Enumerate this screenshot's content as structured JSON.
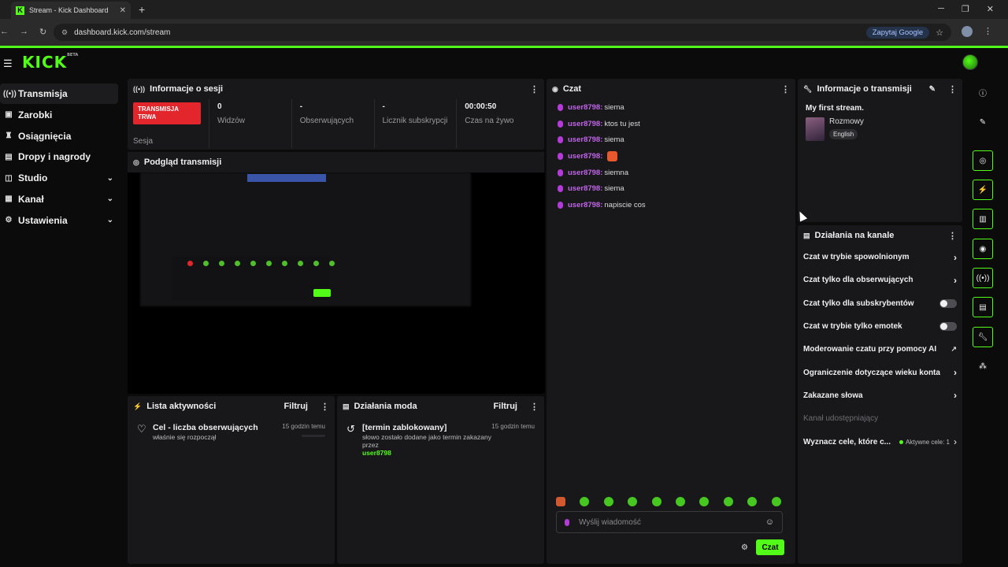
{
  "browser": {
    "tab_title": "Stream - Kick Dashboard",
    "url": "dashboard.kick.com/stream",
    "google_chip": "Zapytaj Google"
  },
  "brand": {
    "logo": "KICK",
    "beta": "BETA",
    "accent": "#53fc18"
  },
  "sidebar": {
    "items": [
      {
        "label": "Transmisja",
        "icon": "broadcast-icon",
        "active": true
      },
      {
        "label": "Zarobki",
        "icon": "wallet-icon"
      },
      {
        "label": "Osiągnięcia",
        "icon": "trophy-icon"
      },
      {
        "label": "Dropy i nagrody",
        "icon": "gift-icon"
      },
      {
        "label": "Studio",
        "icon": "studio-icon",
        "expandable": true
      },
      {
        "label": "Kanał",
        "icon": "channel-icon",
        "expandable": true
      },
      {
        "label": "Ustawienia",
        "icon": "gear-icon",
        "expandable": true
      }
    ]
  },
  "session": {
    "title": "Informacje o sesji",
    "live_badge": "TRANSMISJA TRWA",
    "session_label": "Sesja",
    "viewers_value": "0",
    "viewers_label": "Widzów",
    "followers_value": "-",
    "followers_label": "Obserwujących",
    "subs_value": "-",
    "subs_label": "Licznik subskrypcji",
    "uptime_value": "00:00:50",
    "uptime_label": "Czas na żywo"
  },
  "preview": {
    "title": "Podgląd transmisji"
  },
  "activity": {
    "title": "Lista aktywności",
    "filter": "Filtruj",
    "item_title": "Cel - liczba obserwujących",
    "item_desc": "właśnie się rozpoczął",
    "item_time": "15 godzin temu"
  },
  "modactions": {
    "title": "Działania moda",
    "filter": "Filtruj",
    "item_title": "[termin zablokowany]",
    "item_desc": "słowo zostało dodane jako termin zakazany przez",
    "item_user": "user8798",
    "item_time": "15 godzin temu"
  },
  "chat": {
    "title": "Czat",
    "messages": [
      {
        "user": "user8798:",
        "text": "siema"
      },
      {
        "user": "user8798:",
        "text": "ktos tu jest"
      },
      {
        "user": "user8798:",
        "text": "siema"
      },
      {
        "user": "user8798:",
        "text": "",
        "emote": true
      },
      {
        "user": "user8798:",
        "text": "siemna"
      },
      {
        "user": "user8798:",
        "text": "siema"
      },
      {
        "user": "user8798:",
        "text": "napiscie cos"
      }
    ],
    "placeholder": "Wyślij wiadomość",
    "send": "Czat"
  },
  "streaminfo": {
    "title": "Informacje o transmisji",
    "stream_title": "My first stream.",
    "category": "Rozmowy",
    "language": "English"
  },
  "channel_actions": {
    "title": "Działania na kanale",
    "items": [
      {
        "label": "Czat w trybie spowolnionym",
        "control": "chevron"
      },
      {
        "label": "Czat tylko dla obserwujących",
        "control": "chevron"
      },
      {
        "label": "Czat tylko dla subskrybentów",
        "control": "toggle"
      },
      {
        "label": "Czat w trybie tylko emotek",
        "control": "toggle"
      },
      {
        "label": "Moderowanie czatu przy pomocy AI",
        "control": "external"
      },
      {
        "label": "Ograniczenie dotyczące wieku konta",
        "control": "chevron"
      },
      {
        "label": "Zakazane słowa",
        "control": "chevron"
      },
      {
        "label": "Kanał udostępniający",
        "control": "none",
        "disabled": true
      },
      {
        "label": "Wyznacz cele, które c...",
        "control": "goal",
        "goal_text": "Aktywne cele: 1"
      }
    ]
  }
}
